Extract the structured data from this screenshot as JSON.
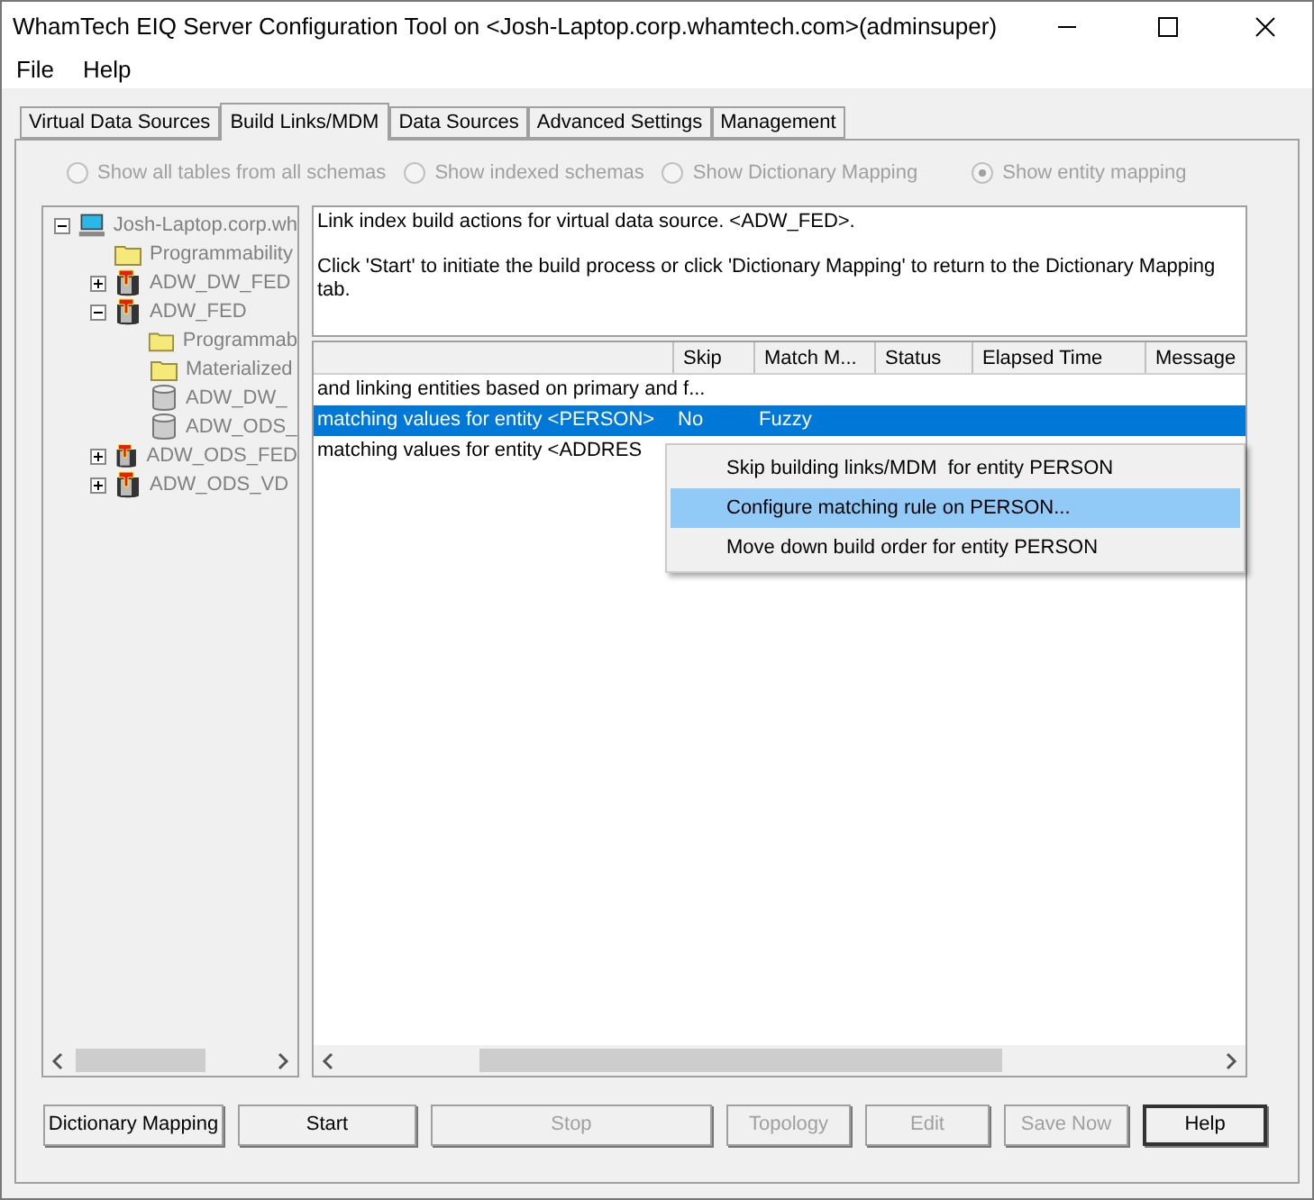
{
  "window": {
    "title": "WhamTech EIQ Server Configuration Tool on <Josh-Laptop.corp.whamtech.com>(adminsuper)"
  },
  "menu": [
    "File",
    "Help"
  ],
  "tabs": [
    {
      "label": "Virtual Data Sources",
      "selected": false
    },
    {
      "label": "Build Links/MDM",
      "selected": true
    },
    {
      "label": "Data Sources",
      "selected": false
    },
    {
      "label": "Advanced Settings",
      "selected": false
    },
    {
      "label": "Management",
      "selected": false
    }
  ],
  "view_options": [
    {
      "label": "Show all tables from all schemas",
      "selected": false
    },
    {
      "label": "Show indexed schemas",
      "selected": false
    },
    {
      "label": "Show Dictionary Mapping",
      "selected": false
    },
    {
      "label": "Show entity mapping",
      "selected": true
    }
  ],
  "tree": [
    {
      "label": "Josh-Laptop.corp.wh",
      "kind": "server",
      "expanded": true,
      "children": [
        {
          "label": "Programmability",
          "kind": "folder"
        },
        {
          "label": "ADW_DW_FED",
          "kind": "federated",
          "expanded": false
        },
        {
          "label": "ADW_FED",
          "kind": "federated",
          "expanded": true,
          "children": [
            {
              "label": "Programmab",
              "kind": "folder"
            },
            {
              "label": "Materialized",
              "kind": "folder"
            },
            {
              "label": "ADW_DW_",
              "kind": "database"
            },
            {
              "label": "ADW_ODS_",
              "kind": "database"
            }
          ]
        },
        {
          "label": "ADW_ODS_FED",
          "kind": "federated",
          "expanded": false
        },
        {
          "label": "ADW_ODS_VD",
          "kind": "federated",
          "expanded": false
        }
      ]
    }
  ],
  "description": [
    "Link index build actions for virtual data source. <ADW_FED>.",
    "Click 'Start' to initiate the build process or click 'Dictionary Mapping' to return to the Dictionary Mapping tab."
  ],
  "table": {
    "columns": [
      "Skip",
      "Match M...",
      "Status",
      "Elapsed Time",
      "Message"
    ],
    "rows": [
      {
        "task": "and linking entities based on primary and f...",
        "cells": [
          "",
          "",
          "",
          "",
          ""
        ],
        "selected": false
      },
      {
        "task": "matching values for entity <PERSON>",
        "cells": [
          "No",
          "Fuzzy",
          "",
          "",
          ""
        ],
        "selected": true
      },
      {
        "task": "matching values for entity <ADDRES",
        "cells": [
          "",
          "",
          "",
          "",
          ""
        ],
        "selected": false
      }
    ]
  },
  "context_menu": [
    {
      "label": "Skip building links/MDM  for entity PERSON",
      "selected": false
    },
    {
      "label": "Configure matching rule on PERSON...",
      "selected": true
    },
    {
      "label": "Move down build order for entity PERSON",
      "selected": false
    }
  ],
  "buttons": [
    {
      "label": "Dictionary Mapping",
      "disabled": false,
      "default": false
    },
    {
      "label": "Start",
      "disabled": false,
      "default": false
    },
    {
      "label": "Stop",
      "disabled": true,
      "default": false
    },
    {
      "label": "Topology",
      "disabled": true,
      "default": false
    },
    {
      "label": "Edit",
      "disabled": true,
      "default": false
    },
    {
      "label": "Save Now",
      "disabled": true,
      "default": false
    },
    {
      "label": "Help",
      "disabled": false,
      "default": true
    }
  ]
}
